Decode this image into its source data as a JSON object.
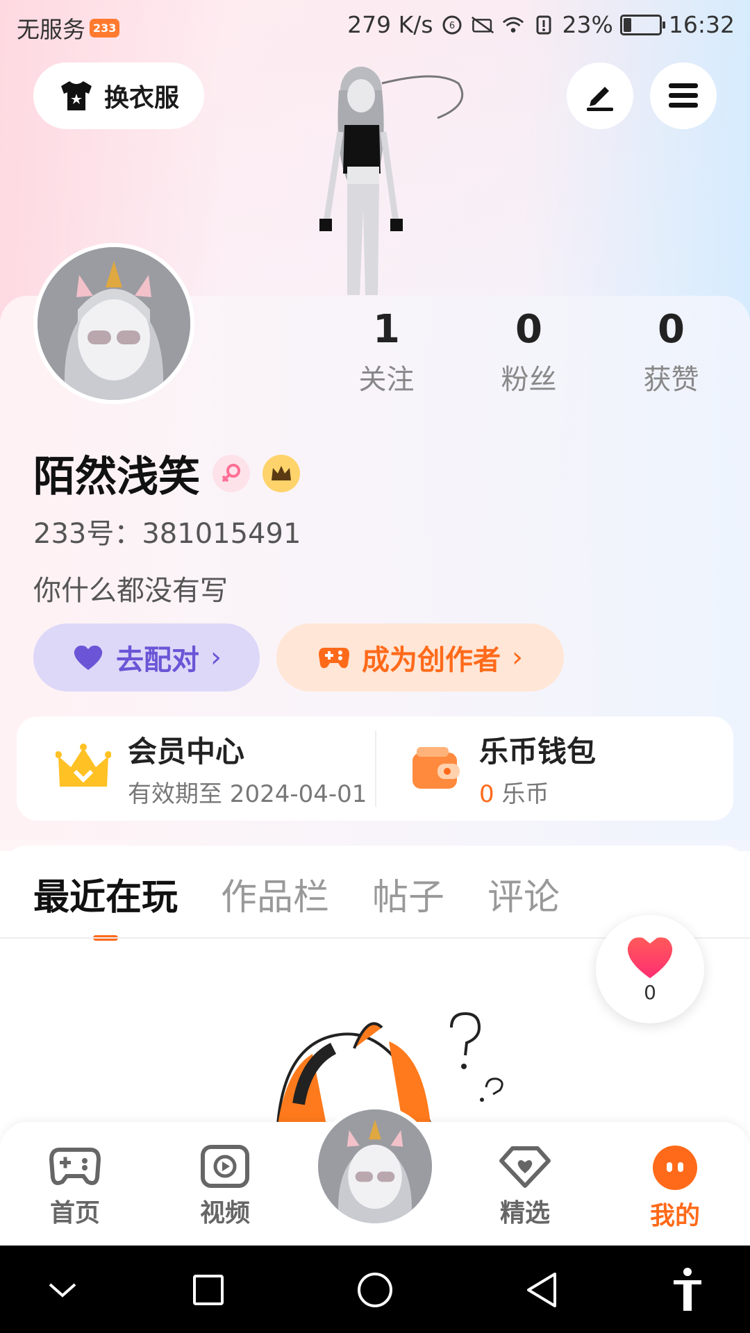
{
  "status_bar": {
    "carrier": "无服务",
    "carrier_badge": "233",
    "net_speed": "279 K/s",
    "battery_pct": "23%",
    "time": "16:32"
  },
  "top_actions": {
    "outfit_label": "换衣服"
  },
  "profile": {
    "stats": [
      {
        "value": "1",
        "label": "关注"
      },
      {
        "value": "0",
        "label": "粉丝"
      },
      {
        "value": "0",
        "label": "获赞"
      }
    ],
    "username": "陌然浅笑",
    "uid": "233号：381015491",
    "bio": "你什么都没有写",
    "match_label": "去配对",
    "creator_label": "成为创作者"
  },
  "member_card": {
    "vip_title": "会员中心",
    "vip_sub": "有效期至 2024-04-01",
    "wallet_title": "乐币钱包",
    "wallet_amount": "0",
    "wallet_unit": "乐币"
  },
  "tabs": [
    {
      "label": "最近在玩",
      "active": true
    },
    {
      "label": "作品栏",
      "active": false
    },
    {
      "label": "帖子",
      "active": false
    },
    {
      "label": "评论",
      "active": false
    }
  ],
  "like_float": {
    "count": "0"
  },
  "bottom_nav": [
    {
      "label": "首页",
      "icon": "gamepad-icon"
    },
    {
      "label": "视频",
      "icon": "video-icon"
    },
    {
      "label": "精选",
      "icon": "heart-diamond-icon"
    },
    {
      "label": "我的",
      "icon": "me-icon",
      "active": true
    }
  ],
  "colors": {
    "accent": "#ff6a1a",
    "match_purple": "#6b55d6",
    "match_bg": "#ddd8f8",
    "creator_bg": "#ffe6d6"
  }
}
